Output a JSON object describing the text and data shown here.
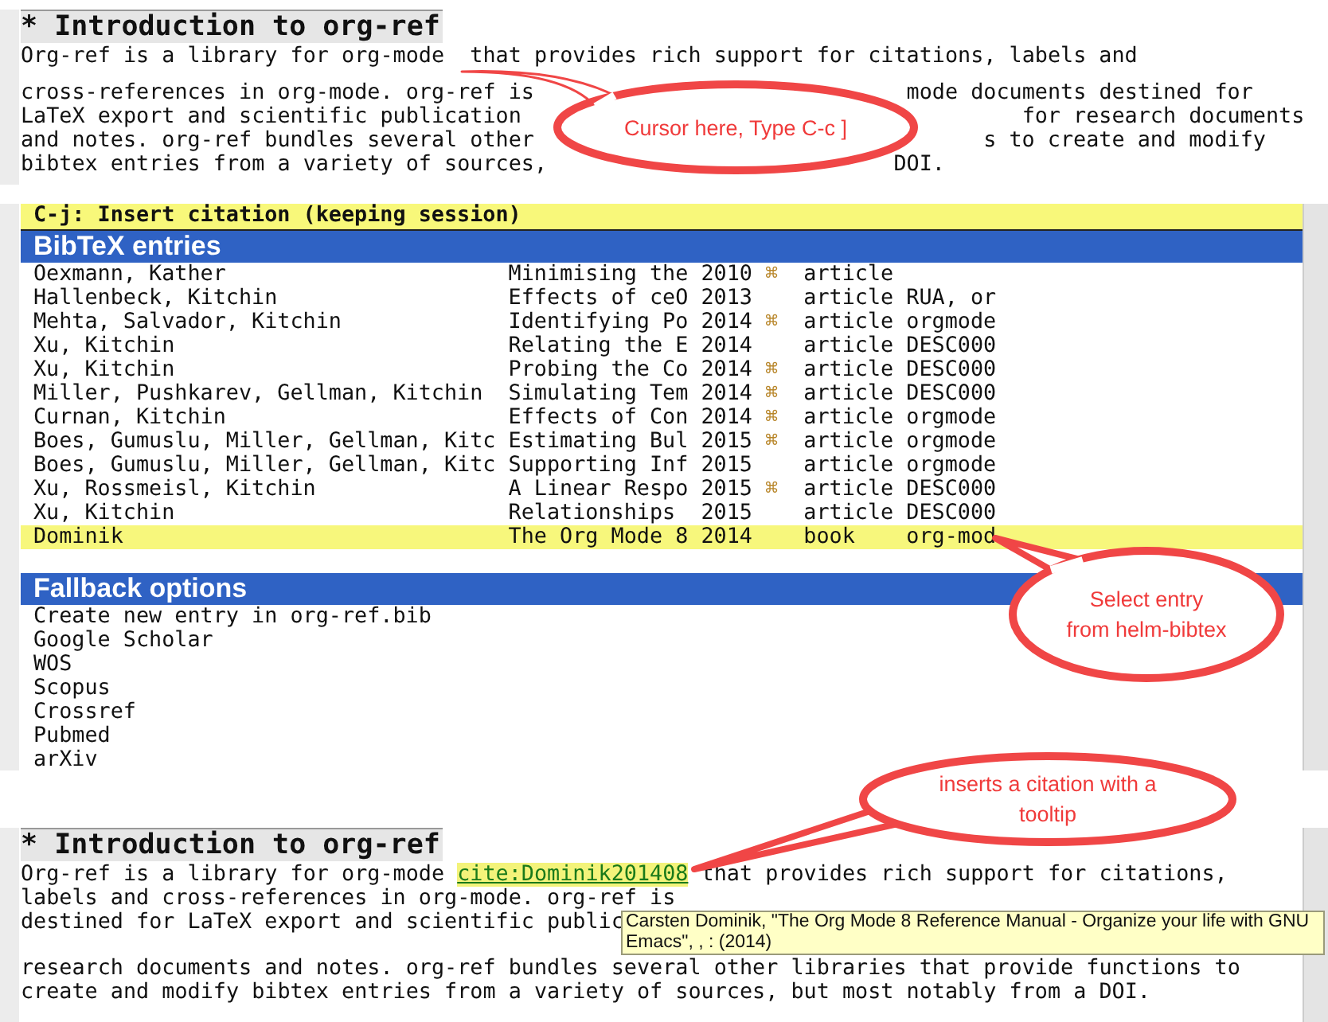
{
  "top_panel": {
    "heading": "* Introduction to org-ref",
    "lines": [
      {
        "left": "Org-ref is a library for org-mode",
        "right": "that provides rich support for citations, labels and"
      },
      {
        "left": "cross-references in org-mode. org-ref is",
        "right": "mode documents destined for"
      },
      {
        "left": "LaTeX export and scientific publication",
        "right": "for research documents"
      },
      {
        "left": "and notes. org-ref bundles several other",
        "right": "s to create and modify"
      },
      {
        "left": "bibtex entries from a variety of sources,",
        "right": "DOI."
      }
    ]
  },
  "helm": {
    "action_line": "C-j: Insert citation (keeping session)",
    "bibtex": {
      "title": "BibTeX entries",
      "rows": [
        {
          "author": "Oexmann, Kather",
          "title": "Minimising the",
          "year": "2010",
          "mark": "⌘",
          "type": "article",
          "selected": false
        },
        {
          "author": "Hallenbeck, Kitchin",
          "title": "Effects of ceO",
          "year": "2013",
          "type": "article",
          "keywords": "RUA, or",
          "selected": false
        },
        {
          "author": "Mehta, Salvador, Kitchin",
          "title": "Identifying Po",
          "year": "2014",
          "mark": "⌘",
          "type": "article",
          "keywords": "orgmode",
          "selected": false
        },
        {
          "author": "Xu, Kitchin",
          "title": "Relating the E",
          "year": "2014",
          "type": "article",
          "keywords": "DESC000",
          "selected": false
        },
        {
          "author": "Xu, Kitchin",
          "title": "Probing the Co",
          "year": "2014",
          "mark": "⌘",
          "type": "article",
          "keywords": "DESC000",
          "selected": false
        },
        {
          "author": "Miller, Pushkarev, Gellman, Kitchin",
          "title": "Simulating Tem",
          "year": "2014",
          "mark": "⌘",
          "type": "article",
          "keywords": "DESC000",
          "selected": false
        },
        {
          "author": "Curnan, Kitchin",
          "title": "Effects of Con",
          "year": "2014",
          "mark": "⌘",
          "type": "article",
          "keywords": "orgmode",
          "selected": false
        },
        {
          "author": "Boes, Gumuslu, Miller, Gellman, Kitc",
          "title": "Estimating Bul",
          "year": "2015",
          "mark": "⌘",
          "type": "article",
          "keywords": "orgmode",
          "selected": false
        },
        {
          "author": "Boes, Gumuslu, Miller, Gellman, Kitc",
          "title": "Supporting Inf",
          "year": "2015",
          "type": "article",
          "keywords": "orgmode",
          "selected": false
        },
        {
          "author": "Xu, Rossmeisl, Kitchin",
          "title": "A Linear Respo",
          "year": "2015",
          "mark": "⌘",
          "type": "article",
          "keywords": "DESC000",
          "selected": false
        },
        {
          "author": "Xu, Kitchin",
          "title": "Relationships",
          "year": "2015",
          "type": "article",
          "keywords": "DESC000",
          "selected": false
        },
        {
          "author": "Dominik",
          "title": "The Org Mode 8",
          "year": "2014",
          "type": "book",
          "keywords": "org-mod",
          "selected": true
        }
      ]
    },
    "fallback": {
      "title": "Fallback options",
      "items": [
        "Create new entry in org-ref.bib",
        "Google Scholar",
        "WOS",
        "Scopus",
        "Crossref",
        "Pubmed",
        "arXiv"
      ]
    }
  },
  "bottom_panel": {
    "heading": "* Introduction to org-ref",
    "first_line": {
      "before": "Org-ref is a library for org-mode",
      "link": "cite:Dominik201408",
      "after": "that provides rich support for citations,"
    },
    "lines": [
      "labels and cross-references in org-mode. org-ref is",
      "destined for LaTeX export and scientific public",
      "research documents and notes. org-ref bundles several other libraries that provide functions to",
      "create and modify bibtex entries from a variety of sources, but most notably from a DOI."
    ],
    "tooltip": {
      "lines": [
        "Carsten Dominik, \"The Org Mode 8 Reference Manual - Organize your life with GNU",
        "Emacs\", , : (2014)"
      ]
    }
  },
  "callouts": [
    {
      "lines": [
        "Cursor here, Type C-c ]"
      ]
    },
    {
      "lines": [
        "Select entry",
        "from helm-bibtex"
      ]
    },
    {
      "lines": [
        "inserts a citation with a",
        "tooltip"
      ]
    }
  ]
}
